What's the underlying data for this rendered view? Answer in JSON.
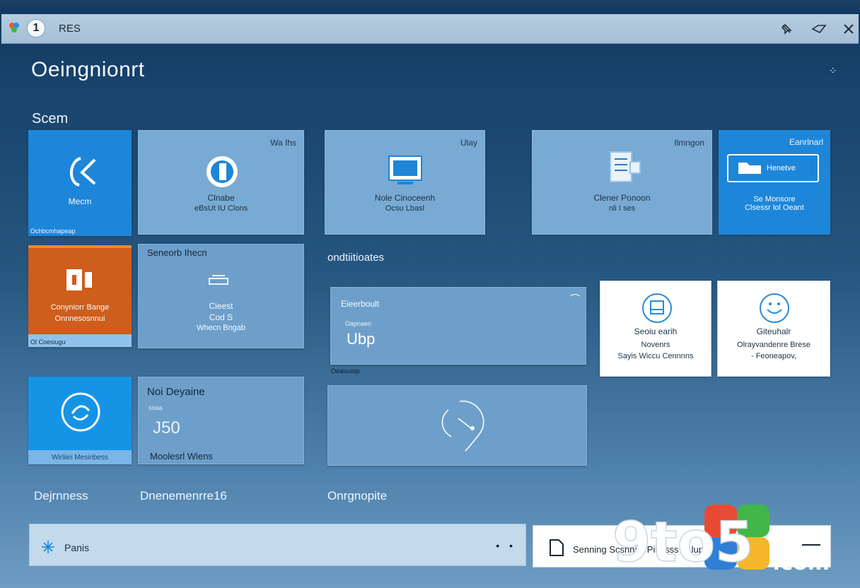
{
  "window": {
    "title": "RES",
    "avatar_glyph": "1"
  },
  "titlebar": {
    "actions": [
      "pin-icon",
      "minimize-icon",
      "close-icon"
    ]
  },
  "page": {
    "title": "Oeingnionrt"
  },
  "sections": {
    "top_label": "Scem",
    "middle_label": "ondtiitioates",
    "bottom_left_label": "Dejrnness",
    "bottom_mid_label": "Dnenemenrre16",
    "bottom_right_label": "Onrgnopite"
  },
  "tiles": {
    "t1": {
      "label": "Mecm",
      "footer": "Ochbcmhapeap"
    },
    "t2": {
      "corner": "Wa Ihs",
      "line1": "Clnabe",
      "line2": "eBsUt IU Clons"
    },
    "t3": {
      "corner": "Ulay",
      "line1": "Nole Cinoceenh",
      "line2": "Ocsu Lbasl"
    },
    "t4": {
      "corner": "Ilmngon",
      "line1": "Clener Ponoon",
      "line2": "nli I ses"
    },
    "t5": {
      "corner": "Eanrlnarl",
      "button": "Henetve",
      "line1": "Se Monsore",
      "line2": "Clsessr lol Oeant"
    },
    "t6": {
      "line1": "Conyniorr Bange",
      "line2": "Onnnesosnnui",
      "footer": "Ol Coesiugu"
    },
    "t7": {
      "heading": "Seneorb Ihecn",
      "line1": "Cieest",
      "line2": "Cod S",
      "line3": "Whecn Bngab"
    },
    "t8": {
      "heading": "Eieerboult",
      "small": "Oapnaen",
      "value": "Ubp",
      "footer": "Oeaisuiop"
    },
    "t9": {
      "line1": "Seoiu earih",
      "line2": "Novenrs",
      "line3": "Sayis Wiccu Cennnns"
    },
    "t10": {
      "line1": "Giteuhalr",
      "line2": "Olrayvandenre Brese",
      "line3": "- Feoneapov,"
    },
    "t11": {
      "footer": "Wirliiei Mesinbess"
    },
    "t12": {
      "heading": "Noi Deyaine",
      "small": "soaa",
      "value": "J50",
      "footer": "Moolesrl Wiens"
    }
  },
  "bottom_bar": {
    "search_text": "Panis",
    "right_text": "Senning Scshni ir Piucsss ... luppy"
  },
  "watermark": {
    "text1": "9to5",
    "text2": ".com"
  },
  "colors": {
    "accent_blue": "#1e86d8",
    "bright_blue": "#1594e6",
    "orange": "#cf5d1b",
    "pale_tile": "#79aad3"
  }
}
